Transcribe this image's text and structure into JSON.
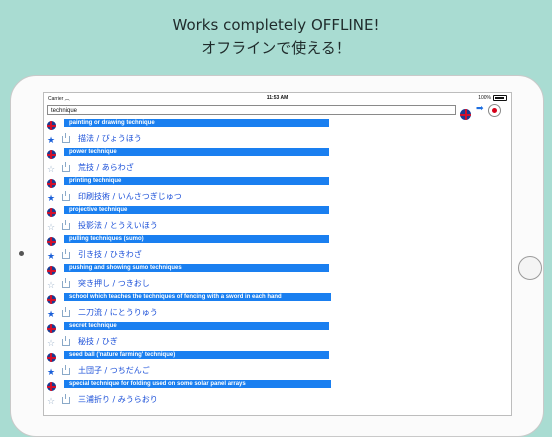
{
  "promo": {
    "line1": "Works completely OFFLINE!",
    "line2": "オフラインで使える！"
  },
  "status": {
    "carrier": "Carrier",
    "time": "11:53 AM",
    "battery": "100%"
  },
  "search": {
    "value": "technique"
  },
  "results": [
    {
      "lang": "en",
      "text": "painting or drawing technique"
    },
    {
      "lang": "jp",
      "text": "描法 / びょうほう",
      "starred": true
    },
    {
      "lang": "en",
      "text": "power technique"
    },
    {
      "lang": "jp",
      "text": "荒技 / あらわざ",
      "starred": false
    },
    {
      "lang": "en",
      "text": "printing technique"
    },
    {
      "lang": "jp",
      "text": "印刷技術 / いんさつぎじゅつ",
      "starred": true
    },
    {
      "lang": "en",
      "text": "projective technique"
    },
    {
      "lang": "jp",
      "text": "投影法 / とうえいほう",
      "starred": false
    },
    {
      "lang": "en",
      "text": "pulling techniques (sumo)"
    },
    {
      "lang": "jp",
      "text": "引き技 / ひきわざ",
      "starred": true
    },
    {
      "lang": "en",
      "text": "pushing and showing sumo techniques"
    },
    {
      "lang": "jp",
      "text": "突き押し / つきおし",
      "starred": false
    },
    {
      "lang": "en",
      "text": "school which teaches the techniques of fencing with a sword in each hand"
    },
    {
      "lang": "jp",
      "text": "二刀流 / にとうりゅう",
      "starred": true
    },
    {
      "lang": "en",
      "text": "secret technique"
    },
    {
      "lang": "jp",
      "text": "秘技 / ひぎ",
      "starred": false
    },
    {
      "lang": "en",
      "text": "seed ball ('nature farming' technique)"
    },
    {
      "lang": "jp",
      "text": "土団子 / つちだんご",
      "starred": true
    },
    {
      "lang": "en",
      "text": "special technique for folding used on some solar panel arrays"
    },
    {
      "lang": "jp",
      "text": "三浦折り / みうらおり",
      "starred": false
    }
  ]
}
